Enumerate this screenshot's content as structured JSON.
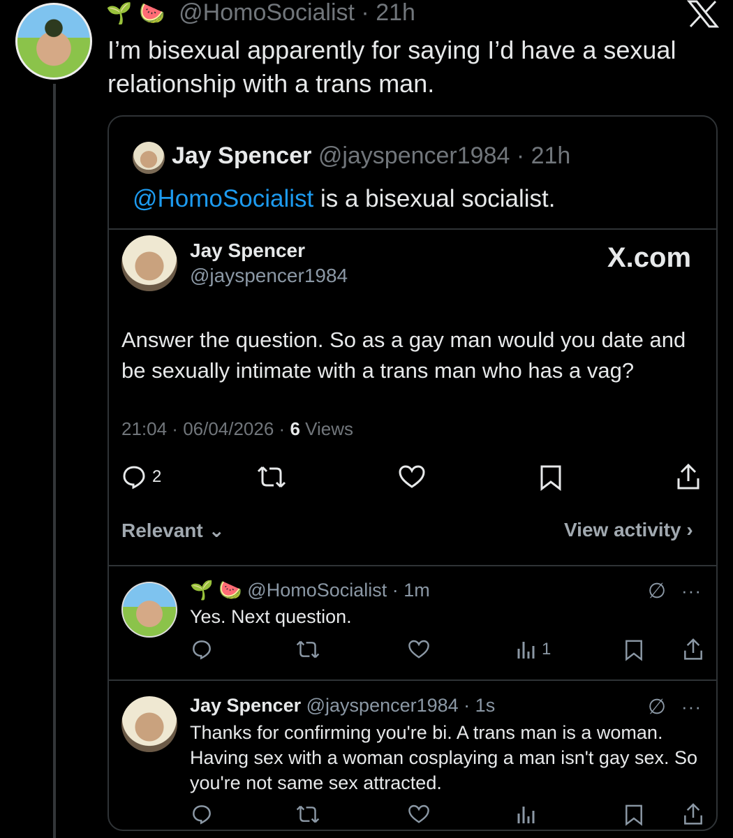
{
  "post": {
    "emojis": [
      "🌱",
      "🍉"
    ],
    "handle": "@HomoSocialist",
    "time": "21h",
    "text": "I’m bisexual apparently for saying I’d have a sexual relationship with a trans man."
  },
  "quote": {
    "name": "Jay Spencer",
    "handle": "@jayspencer1984",
    "time": "21h",
    "mention": "@HomoSocialist",
    "text_rest": " is a bisexual socialist."
  },
  "screenshot": {
    "name": "Jay Spencer",
    "handle": "@jayspencer1984",
    "brand": "X.com",
    "text": "Answer the question. So as a gay man would you date and be sexually intimate with a trans man who has a vag?",
    "time": "21:04",
    "date": "06/04/2026",
    "views_count": "6",
    "views_label": "Views",
    "reply_count": "2",
    "sort_label": "Relevant",
    "view_activity": "View activity"
  },
  "replies": [
    {
      "emojis": [
        "🌱",
        "🍉"
      ],
      "handle": "@HomoSocialist",
      "time": "1m",
      "text": "Yes. Next question.",
      "views": "1"
    },
    {
      "name": "Jay Spencer",
      "handle": "@jayspencer1984",
      "time": "1s",
      "text": "Thanks for confirming you're bi. A trans man is a woman. Having sex with a woman cosplaying a man isn't gay sex. So you're not same sex attracted."
    }
  ],
  "icons": {
    "top_right": "x-logo-icon",
    "reply": "reply-icon",
    "repost": "repost-icon",
    "like": "like-icon",
    "bookmark": "bookmark-icon",
    "share": "share-icon",
    "views": "views-icon",
    "grok": "grok-icon",
    "more": "more-icon"
  },
  "colors": {
    "background": "#000000",
    "text": "#e7e9ea",
    "secondary": "#71767b",
    "link": "#1d9bf0",
    "border": "#2f3336"
  }
}
